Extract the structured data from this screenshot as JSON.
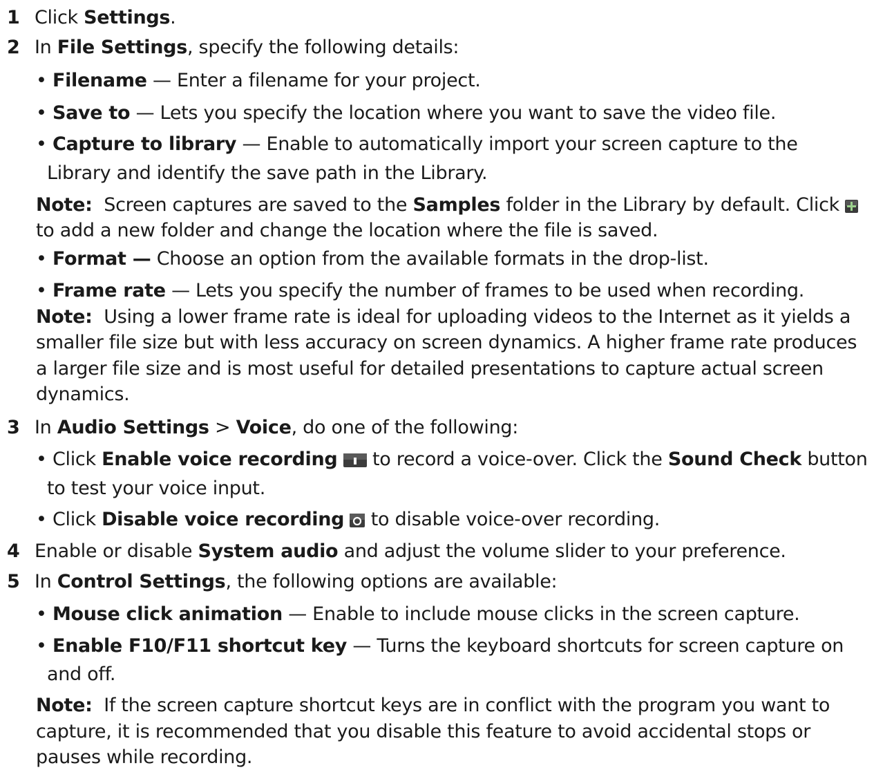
{
  "steps": [
    {
      "number": "1",
      "pre": "Click ",
      "bold": "Settings",
      "post": "."
    },
    {
      "number": "2",
      "pre": "In ",
      "bold": "File Settings",
      "post": ", specify the following details:",
      "bullets": [
        {
          "label": "Filename",
          "text": " — Enter a filename for your project."
        },
        {
          "label": "Save to",
          "text": " — Lets you specify the location where you want to save the video file."
        },
        {
          "label": "Capture to library",
          "text": " — Enable to automatically import your screen capture to the",
          "text2": "Library and identify the save path in the Library."
        }
      ],
      "note1": {
        "label": "Note:",
        "pre": "  Screen captures are saved to the ",
        "bold": "Samples",
        "post": " folder in the Library by default. Click ",
        "icon": "add-folder-icon",
        "line2": "to add a new folder and change the location where the file is saved."
      },
      "bullets2": [
        {
          "label": "Format —",
          "text": " Choose an option from the available formats in the drop-list."
        },
        {
          "label": "Frame rate",
          "text": " — Lets you specify the number of frames to be used when recording."
        }
      ],
      "note2": {
        "label": "Note:",
        "lines": [
          "  Using a lower frame rate is ideal for uploading videos to the Internet as it yields a",
          "smaller file size but with less accuracy on screen dynamics. A higher frame rate produces",
          "a larger file size and is most useful for detailed presentations to capture actual screen",
          "dynamics."
        ]
      }
    },
    {
      "number": "3",
      "pre": "In ",
      "bold": "Audio Settings",
      "mid": " > ",
      "bold2": "Voice",
      "post": ", do one of the following:",
      "bullets": [
        {
          "pre": "Click ",
          "label": "Enable voice recording",
          "icon": "enable-voice-recording-icon",
          "text": " to record a voice-over. Click the ",
          "bold2": "Sound Check",
          "text2": " button",
          "text3": "to test your voice input."
        },
        {
          "pre": "Click ",
          "label": "Disable voice recording",
          "icon": "disable-voice-recording-icon",
          "text": " to disable voice-over recording."
        }
      ]
    },
    {
      "number": "4",
      "pre": "Enable or disable ",
      "bold": "System audio",
      "post": " and adjust the volume slider to your preference."
    },
    {
      "number": "5",
      "pre": "In ",
      "bold": "Control Settings",
      "post": ", the following options are available:",
      "bullets": [
        {
          "label": "Mouse click animation",
          "text": " — Enable to include mouse clicks in the screen capture."
        },
        {
          "label": "Enable F10/F11 shortcut key",
          "text": " — Turns the keyboard shortcuts for screen capture on",
          "text2": "and off."
        }
      ],
      "note": {
        "label": "Note:",
        "lines": [
          "  If the screen capture shortcut keys are in conflict with the program you want to",
          "capture, it is recommended that you disable this feature to avoid accidental stops or",
          "pauses while recording."
        ]
      }
    }
  ],
  "bullet_char": "•"
}
